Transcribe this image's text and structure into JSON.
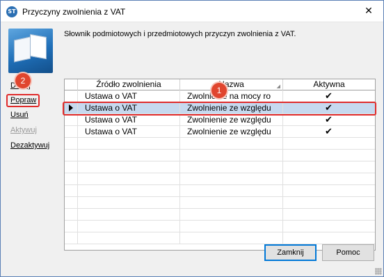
{
  "window": {
    "title": "Przyczyny zwolnienia z VAT",
    "close_glyph": "✕",
    "app_icon_text": "ST"
  },
  "description": "Słownik podmiotowych i przedmiotowych przyczyn zwolnienia z VAT.",
  "side_links": [
    {
      "label": "Dodaj",
      "enabled": true
    },
    {
      "label": "Popraw",
      "enabled": true
    },
    {
      "label": "Usuń",
      "enabled": true
    },
    {
      "label": "Aktywuj",
      "enabled": false
    },
    {
      "label": "Dezaktywuj",
      "enabled": true
    }
  ],
  "grid": {
    "columns": [
      "Źródło zwolnienia",
      "Nazwa",
      "Aktywna"
    ],
    "rows": [
      {
        "source": "Ustawa o VAT",
        "name": "Zwolnienie na mocy ro",
        "active": "✔",
        "selected": false
      },
      {
        "source": "Ustawa o VAT",
        "name": "Zwolnienie ze względu",
        "active": "✔",
        "selected": true
      },
      {
        "source": "Ustawa o VAT",
        "name": "Zwolnienie ze względu",
        "active": "✔",
        "selected": false
      },
      {
        "source": "Ustawa o VAT",
        "name": "Zwolnienie ze względu",
        "active": "✔",
        "selected": false
      }
    ]
  },
  "buttons": {
    "close": "Zamknij",
    "help": "Pomoc"
  },
  "annotations": {
    "badge1": "1",
    "badge2": "2",
    "color": "#e0452e"
  },
  "icons": {
    "app": "app-logo-icon",
    "book": "book-icon",
    "close": "close-icon",
    "row_pointer": "row-pointer-icon",
    "check": "checkmark-icon"
  }
}
